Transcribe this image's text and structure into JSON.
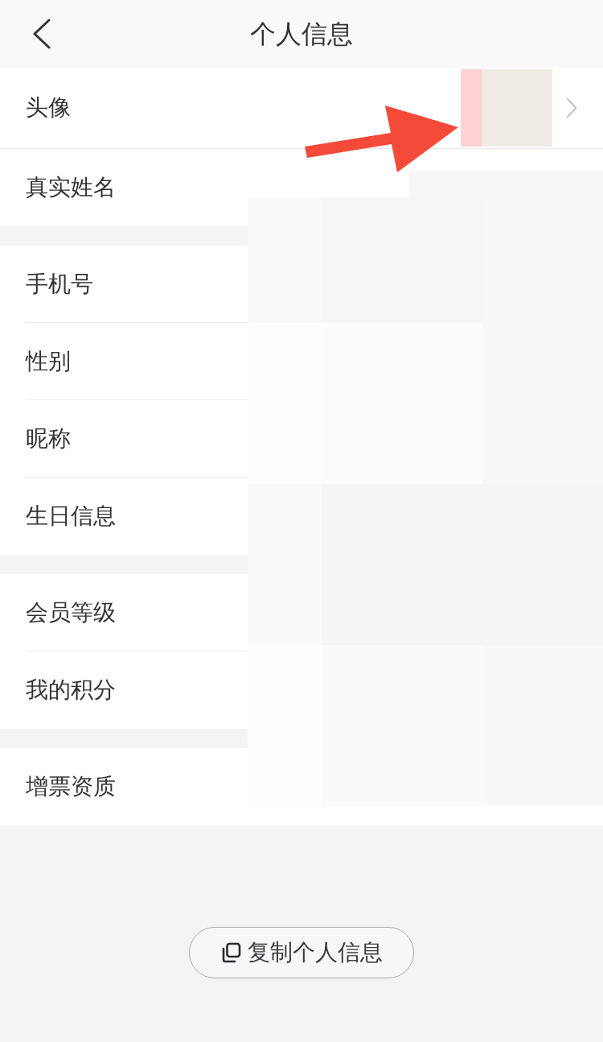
{
  "header": {
    "title": "个人信息"
  },
  "sections": [
    {
      "rows": [
        {
          "label": "头像",
          "kind": "avatar"
        },
        {
          "label": "真实姓名",
          "kind": "text"
        }
      ]
    },
    {
      "rows": [
        {
          "label": "手机号",
          "kind": "text"
        },
        {
          "label": "性别",
          "kind": "text"
        },
        {
          "label": "昵称",
          "kind": "text"
        },
        {
          "label": "生日信息",
          "kind": "text"
        }
      ]
    },
    {
      "rows": [
        {
          "label": "会员等级",
          "kind": "text"
        },
        {
          "label": "我的积分",
          "kind": "text"
        }
      ]
    },
    {
      "rows": [
        {
          "label": "增票资质",
          "kind": "text"
        }
      ]
    }
  ],
  "copy_button": {
    "label": "复制个人信息"
  }
}
